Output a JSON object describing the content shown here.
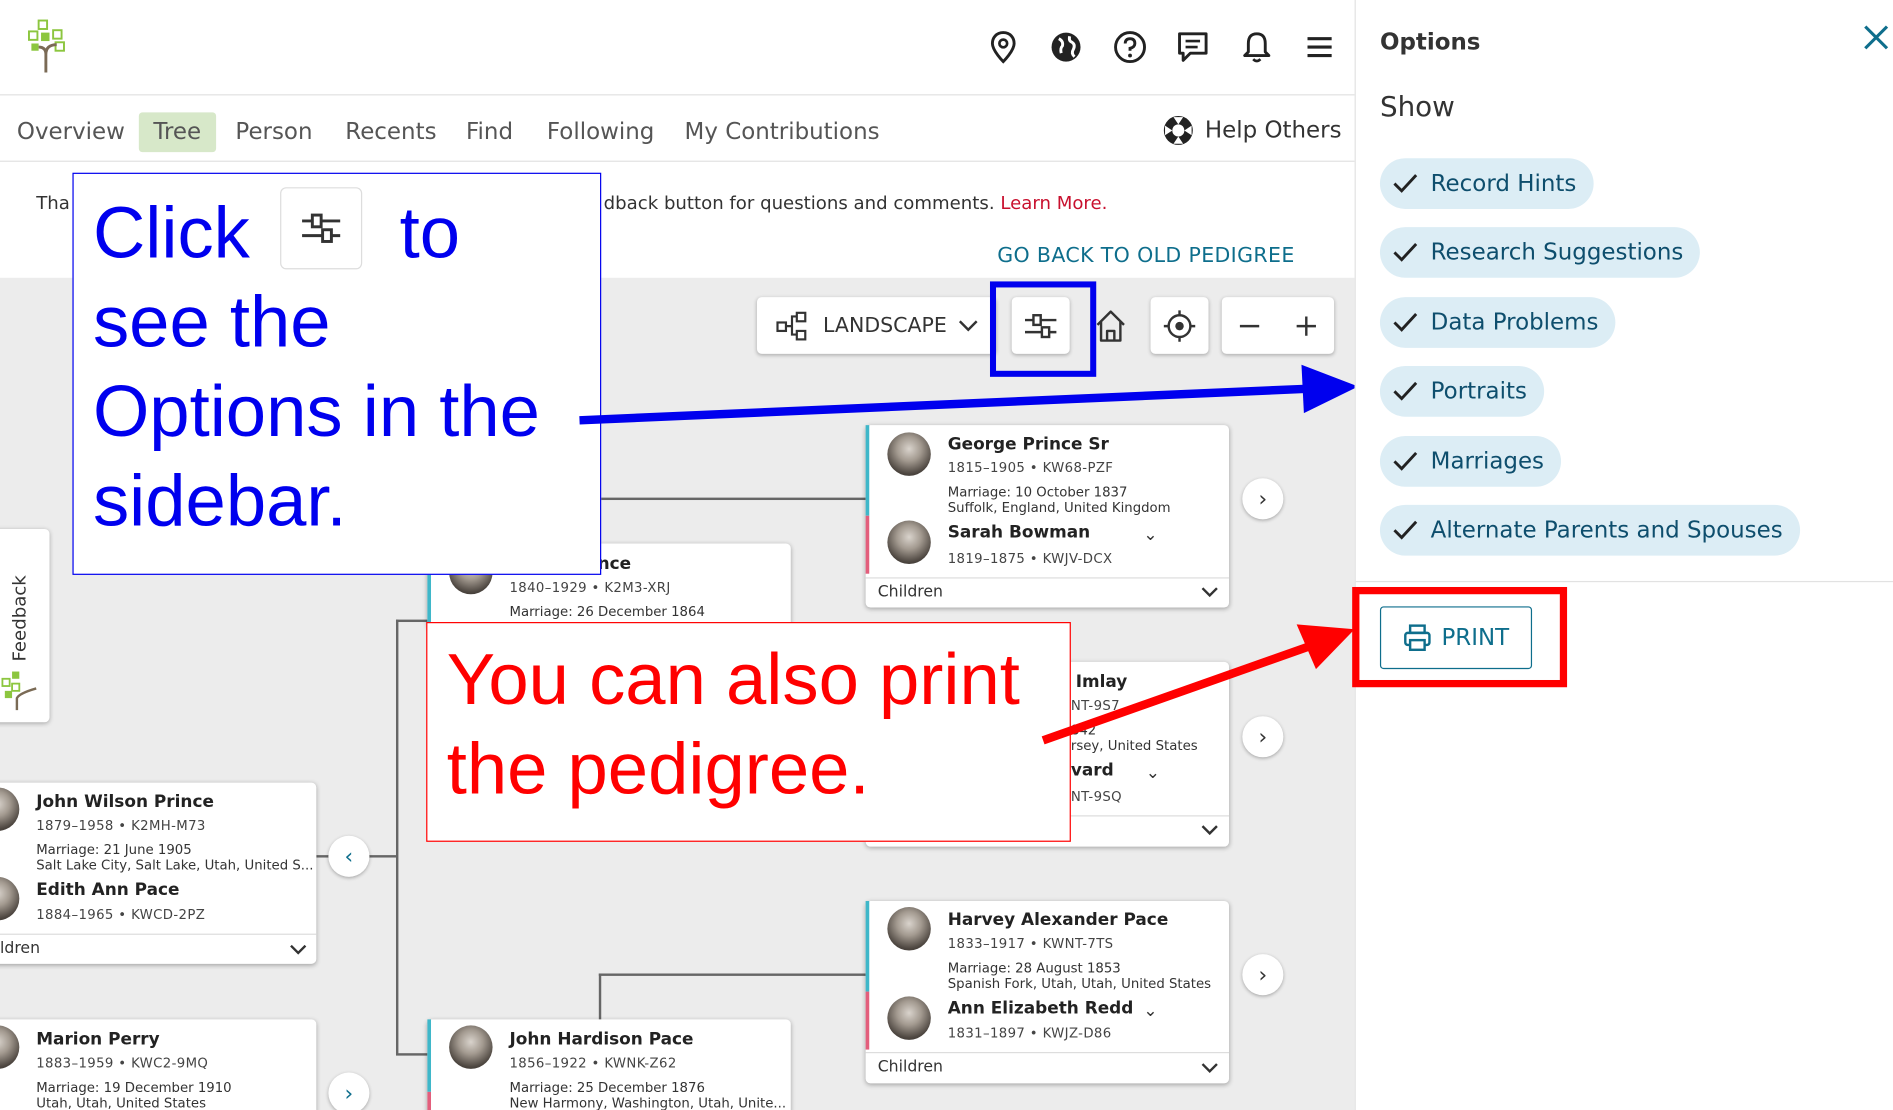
{
  "header": {
    "icons": [
      "location-pin-icon",
      "globe-icon",
      "help-icon",
      "chat-icon",
      "bell-icon",
      "menu-icon"
    ]
  },
  "nav": {
    "tabs": [
      {
        "label": "Overview"
      },
      {
        "label": "Tree",
        "active": true
      },
      {
        "label": "Person"
      },
      {
        "label": "Recents"
      },
      {
        "label": "Find"
      },
      {
        "label": "Following"
      },
      {
        "label": "My Contributions"
      }
    ],
    "help_others": "Help Others"
  },
  "notice": {
    "prefix": "Tha",
    "text": "dback button for questions and comments.",
    "link": "Learn More."
  },
  "go_back": "GO BACK TO OLD PEDIGREE",
  "toolbar": {
    "layout_label": "LANDSCAPE"
  },
  "feedback_label": "Feedback",
  "cards": [
    {
      "name": "George Prince Sr",
      "dates": "1815–1905 •  KW68-PZF",
      "marriage": "Marriage: 10 October 1837",
      "place": "Suffolk, England, United Kingdom",
      "spouse": "Sarah Bowman",
      "spouse_dates": "1819–1875 •  KWJV-DCX",
      "children": "Children"
    },
    {
      "name": "nce",
      "dates": "1840–1929 •  K2M3-XRJ",
      "marriage": "Marriage: 26 December 1864"
    },
    {
      "name": "Imlay",
      "dates": "NT-9S7",
      "marriage": "842",
      "place": "rsey, United States",
      "spouse": "vard",
      "spouse_dates": "NT-9SQ"
    },
    {
      "name": "John Wilson Prince",
      "dates": "1879–1958 •  K2MH-M73",
      "marriage": "Marriage: 21 June 1905",
      "place": "Salt Lake City, Salt Lake, Utah, United S...",
      "spouse": "Edith Ann Pace",
      "spouse_dates": "1884–1965 •  KWCD-2PZ",
      "children": "ldren"
    },
    {
      "name": "Harvey Alexander Pace",
      "dates": "1833–1917 •  KWNT-7TS",
      "marriage": "Marriage: 28 August 1853",
      "place": "Spanish Fork, Utah, Utah, United States",
      "spouse": "Ann Elizabeth Redd",
      "spouse_dates": "1831–1897 •  KWJZ-D86",
      "children": "Children"
    },
    {
      "name": "Marion Perry",
      "dates": "1883–1959 •  KWC2-9MQ",
      "marriage": "Marriage: 19 December 1910",
      "place": "Utah, Utah, United States"
    },
    {
      "name": "John Hardison Pace",
      "dates": "1856–1922 •  KWNK-Z62",
      "marriage": "Marriage: 25 December 1876",
      "place": "New Harmony, Washington, Utah, Unite..."
    }
  ],
  "callouts": {
    "blue": {
      "click": "Click",
      "to": "to",
      "line2": "see the",
      "line3": "Options in the",
      "line4": "sidebar."
    },
    "red": {
      "line1": "You can also print",
      "line2": "the pedigree."
    }
  },
  "sidebar": {
    "title": "Options",
    "show": "Show",
    "options": [
      "Record Hints",
      "Research Suggestions",
      "Data Problems",
      "Portraits",
      "Marriages",
      "Alternate Parents and Spouses"
    ],
    "print": "PRINT"
  },
  "colors": {
    "accent_blue": "#0000ee",
    "accent_red": "#ff0000",
    "teal": "#0e6e8c",
    "pill_bg": "#dcedf5",
    "active_tab": "#d7e8c9"
  }
}
